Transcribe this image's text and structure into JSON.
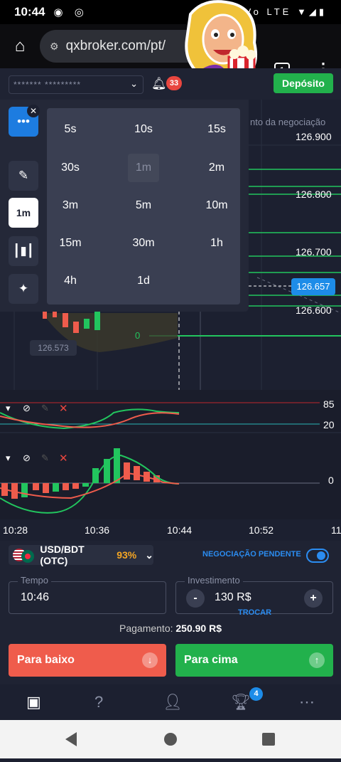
{
  "status_bar": {
    "time": "10:44",
    "network": "Vo LTE"
  },
  "browser": {
    "url": "qxbroker.com/pt/",
    "tab_count": "1"
  },
  "header": {
    "account_masked": "******* *********",
    "notifications": "33",
    "deposit_label": "Depósito"
  },
  "timeframe_menu": {
    "selected": "1m",
    "options": [
      "5s",
      "10s",
      "15s",
      "30s",
      "1m",
      "2m",
      "3m",
      "5m",
      "10m",
      "15m",
      "30m",
      "1h",
      "4h",
      "1d"
    ]
  },
  "toolbar": {
    "timeframe_label": "1m"
  },
  "chart": {
    "overlay_text": "nto da negociação",
    "price_axis": [
      "126.900",
      "126.800",
      "126.700",
      "126.600"
    ],
    "current_price": "126.657",
    "candle_tag": "126.573",
    "zero_label": "0",
    "time_axis": [
      "10:28",
      "10:36",
      "10:44",
      "10:52",
      "11"
    ],
    "stochastic_levels": [
      "85",
      "20"
    ],
    "macd_level": "0"
  },
  "asset": {
    "pair": "USD/BDT (OTC)",
    "payout_pct": "93%"
  },
  "pending": {
    "label": "NEGOCIAÇÃO PENDENTE"
  },
  "time_field": {
    "label": "Tempo",
    "value": "10:46"
  },
  "investment": {
    "label": "Investimento",
    "value": "130 R$",
    "swap_label": "TROCAR"
  },
  "payout": {
    "label": "Pagamento:",
    "value": "250.90 R$"
  },
  "actions": {
    "down_label": "Para baixo",
    "up_label": "Para cima"
  },
  "bottom_nav": {
    "trophy_badge": "4"
  },
  "colors": {
    "accent": "#1d8ce8",
    "up": "#22b14c",
    "down": "#ef5c4c",
    "bg": "#1c2030"
  }
}
